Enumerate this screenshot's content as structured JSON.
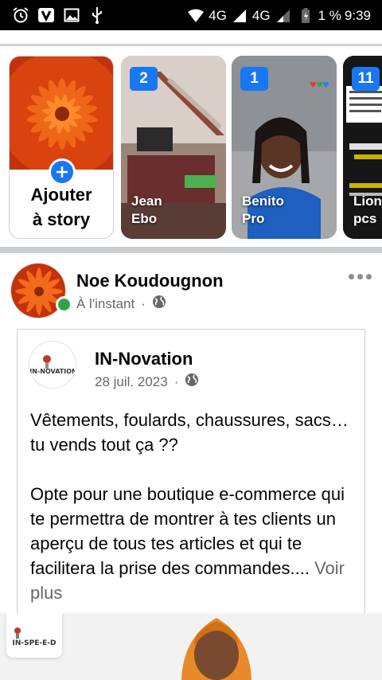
{
  "status_bar": {
    "network1": "4G",
    "network2": "4G",
    "battery": "1 %",
    "time": "9:39"
  },
  "stories": {
    "add_label_line1": "Ajouter",
    "add_label_line2": "à story",
    "items": [
      {
        "count": "2",
        "name_line1": "Jean",
        "name_line2": "Ebo"
      },
      {
        "count": "1",
        "name_line1": "Benito",
        "name_line2": "Pro"
      },
      {
        "count": "11",
        "name_line1": "Lione",
        "name_line2": "pcs"
      }
    ]
  },
  "post": {
    "author": "Noe Koudougnon",
    "time": "À l'instant",
    "shared": {
      "page_name": "IN-Novation",
      "date": "28 juil. 2023",
      "logo_text": "IN-NOVATION",
      "text_p1": "Vêtements, foulards, chaussures, sacs… tu vends tout ça ??",
      "text_p2": "Opte pour une boutique e-commerce qui te permettra de montrer à tes clients un aperçu de tous tes articles et qui te facilitera la prise des commandes....",
      "see_more": "Voir plus"
    },
    "banner_logo": "IN-SPE-E-D"
  },
  "colors": {
    "accent": "#1877f2",
    "online": "#31a24c",
    "meta_text": "#65676b"
  }
}
